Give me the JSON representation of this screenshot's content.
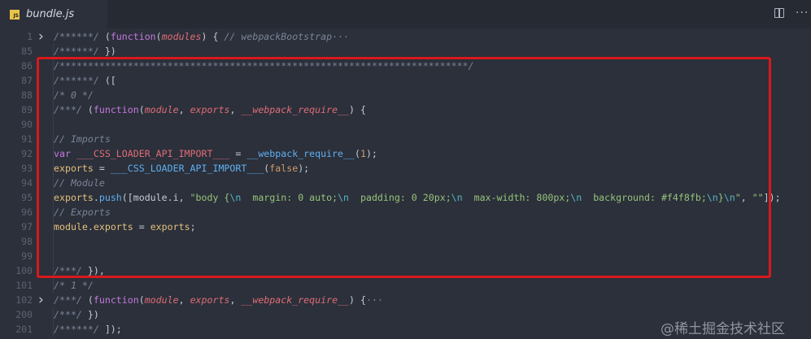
{
  "tab": {
    "badge": "JS",
    "title": "bundle.js"
  },
  "toolbar": {
    "split_icon": "split-editor-icon",
    "more_icon": "more-actions-icon",
    "more_glyph": "···"
  },
  "lines": [
    {
      "num": "1",
      "folded": true,
      "tokens": [
        [
          "c",
          "/******/"
        ],
        [
          "f",
          " ("
        ],
        [
          "k",
          "function"
        ],
        [
          "f",
          "("
        ],
        [
          "p",
          "modules"
        ],
        [
          "f",
          ") { "
        ],
        [
          "c",
          "// webpackBootstrap"
        ],
        [
          "c",
          "···"
        ]
      ]
    },
    {
      "num": "85",
      "folded": false,
      "tokens": [
        [
          "c",
          "/******/"
        ],
        [
          "f",
          " })"
        ]
      ]
    },
    {
      "num": "86",
      "folded": false,
      "tokens": [
        [
          "c",
          "/************************************************************************/"
        ]
      ]
    },
    {
      "num": "87",
      "folded": false,
      "tokens": [
        [
          "c",
          "/******/"
        ],
        [
          "f",
          " (["
        ]
      ]
    },
    {
      "num": "88",
      "folded": false,
      "tokens": [
        [
          "c",
          "/* 0 */"
        ]
      ]
    },
    {
      "num": "89",
      "folded": false,
      "tokens": [
        [
          "c",
          "/***/"
        ],
        [
          "f",
          " ("
        ],
        [
          "k",
          "function"
        ],
        [
          "f",
          "("
        ],
        [
          "p",
          "module"
        ],
        [
          "f",
          ", "
        ],
        [
          "p",
          "exports"
        ],
        [
          "f",
          ", "
        ],
        [
          "p",
          "__webpack_require__"
        ],
        [
          "f",
          ") {"
        ]
      ]
    },
    {
      "num": "90",
      "folded": false,
      "tokens": []
    },
    {
      "num": "91",
      "folded": false,
      "tokens": [
        [
          "c",
          "// Imports"
        ]
      ]
    },
    {
      "num": "92",
      "folded": false,
      "tokens": [
        [
          "k",
          "var"
        ],
        [
          "f",
          " "
        ],
        [
          "v",
          "___CSS_LOADER_API_IMPORT___"
        ],
        [
          "f",
          " = "
        ],
        [
          "fn",
          "__webpack_require__"
        ],
        [
          "f",
          "("
        ],
        [
          "n",
          "1"
        ],
        [
          "f",
          ");"
        ]
      ]
    },
    {
      "num": "93",
      "folded": false,
      "tokens": [
        [
          "m",
          "exports"
        ],
        [
          "f",
          " = "
        ],
        [
          "fn",
          "___CSS_LOADER_API_IMPORT___"
        ],
        [
          "f",
          "("
        ],
        [
          "n",
          "false"
        ],
        [
          "f",
          ");"
        ]
      ]
    },
    {
      "num": "94",
      "folded": false,
      "tokens": [
        [
          "c",
          "// Module"
        ]
      ]
    },
    {
      "num": "95",
      "folded": false,
      "tokens": [
        [
          "m",
          "exports"
        ],
        [
          "f",
          "."
        ],
        [
          "fn",
          "push"
        ],
        [
          "f",
          "([module.i, "
        ],
        [
          "s",
          "\"body {"
        ],
        [
          "e",
          "\\n"
        ],
        [
          "s",
          "  margin: 0 auto;"
        ],
        [
          "e",
          "\\n"
        ],
        [
          "s",
          "  padding: 0 20px;"
        ],
        [
          "e",
          "\\n"
        ],
        [
          "s",
          "  max-width: 800px;"
        ],
        [
          "e",
          "\\n"
        ],
        [
          "s",
          "  background: #f4f8fb;"
        ],
        [
          "e",
          "\\n"
        ],
        [
          "s",
          "}"
        ],
        [
          "e",
          "\\n"
        ],
        [
          "s",
          "\""
        ],
        [
          "f",
          ", "
        ],
        [
          "s",
          "\"\""
        ],
        [
          "f",
          "]);"
        ]
      ]
    },
    {
      "num": "96",
      "folded": false,
      "tokens": [
        [
          "c",
          "// Exports"
        ]
      ]
    },
    {
      "num": "97",
      "folded": false,
      "tokens": [
        [
          "m",
          "module"
        ],
        [
          "f",
          "."
        ],
        [
          "m",
          "exports"
        ],
        [
          "f",
          " = "
        ],
        [
          "m",
          "exports"
        ],
        [
          "f",
          ";"
        ]
      ]
    },
    {
      "num": "98",
      "folded": false,
      "tokens": []
    },
    {
      "num": "99",
      "folded": false,
      "tokens": []
    },
    {
      "num": "100",
      "folded": false,
      "tokens": [
        [
          "c",
          "/***/"
        ],
        [
          "f",
          " }),"
        ]
      ]
    },
    {
      "num": "101",
      "folded": false,
      "tokens": [
        [
          "c",
          "/* 1 */"
        ]
      ]
    },
    {
      "num": "102",
      "folded": true,
      "tokens": [
        [
          "c",
          "/***/"
        ],
        [
          "f",
          " ("
        ],
        [
          "k",
          "function"
        ],
        [
          "f",
          "("
        ],
        [
          "p",
          "module"
        ],
        [
          "f",
          ", "
        ],
        [
          "p",
          "exports"
        ],
        [
          "f",
          ", "
        ],
        [
          "p",
          "__webpack_require__"
        ],
        [
          "f",
          ") {"
        ],
        [
          "c",
          "···"
        ]
      ]
    },
    {
      "num": "200",
      "folded": false,
      "tokens": [
        [
          "c",
          "/***/"
        ],
        [
          "f",
          " })"
        ]
      ]
    },
    {
      "num": "201",
      "folded": false,
      "tokens": [
        [
          "c",
          "/******/"
        ],
        [
          "f",
          " ]);"
        ]
      ]
    }
  ],
  "colors": {
    "highlight": "#d8191a",
    "background": "#2b303b",
    "tab_bar": "#252a33"
  },
  "watermark": "@稀土掘金技术社区"
}
